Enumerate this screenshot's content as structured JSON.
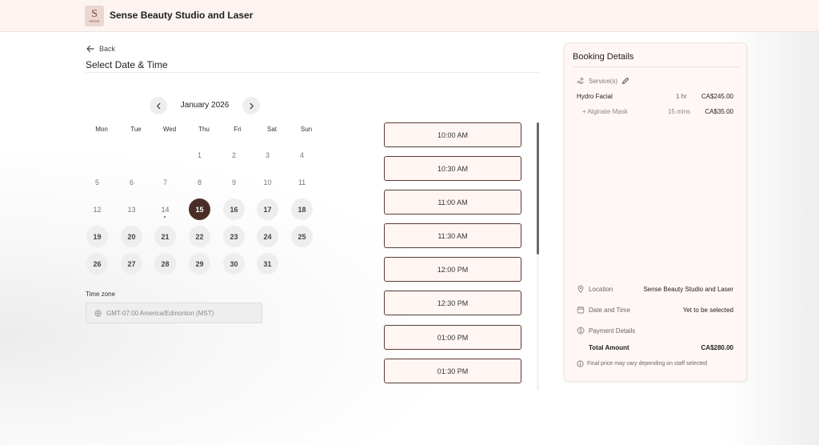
{
  "header": {
    "brand_name": "Sense Beauty Studio and Laser",
    "logo_letter": "S",
    "logo_text": "SENSE"
  },
  "nav": {
    "back_label": "Back"
  },
  "page": {
    "title": "Select Date & Time"
  },
  "calendar": {
    "month_label": "January 2026",
    "weekdays": [
      "Mon",
      "Tue",
      "Wed",
      "Thu",
      "Fri",
      "Sat",
      "Sun"
    ],
    "days": [
      "1",
      "2",
      "3",
      "4",
      "5",
      "6",
      "7",
      "8",
      "9",
      "10",
      "11",
      "12",
      "13",
      "14",
      "15",
      "16",
      "17",
      "18",
      "19",
      "20",
      "21",
      "22",
      "23",
      "24",
      "25",
      "26",
      "27",
      "28",
      "29",
      "30",
      "31"
    ],
    "selected_day": "15",
    "today_day": "14"
  },
  "timezone": {
    "label": "Time zone",
    "value": "GMT-07:00 America/Edmonton (MST)"
  },
  "time_slots": [
    "10:00 AM",
    "10:30 AM",
    "11:00 AM",
    "11:30 AM",
    "12:00 PM",
    "12:30 PM",
    "01:00 PM",
    "01:30 PM"
  ],
  "booking": {
    "title": "Booking Details",
    "services_label": "Service(s)",
    "service": {
      "name": "Hydro Facial",
      "duration": "1 hr",
      "price": "CA$245.00"
    },
    "addon": {
      "name": "+ Alginate Mask",
      "duration": "15 mins",
      "price": "CA$35.00"
    },
    "location_label": "Location",
    "location_value": "Sense Beauty Studio and Laser",
    "datetime_label": "Date and Time",
    "datetime_value": "Yet to be selected",
    "payment_label": "Payment Details",
    "total_label": "Total Amount",
    "total_value": "CA$280.00",
    "note": "Final price may vary depending on staff selected"
  }
}
